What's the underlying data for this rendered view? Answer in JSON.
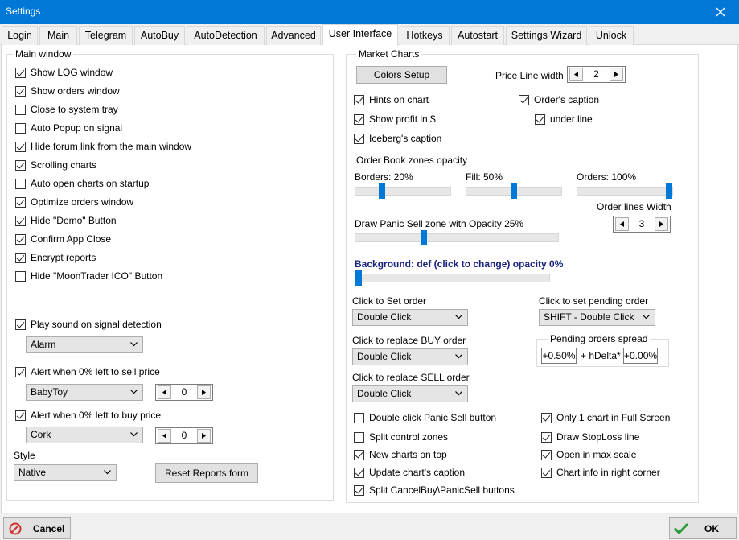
{
  "window": {
    "title": "Settings"
  },
  "tabs": [
    "Login",
    "Main",
    "Telegram",
    "AutoBuy",
    "AutoDetection",
    "Advanced",
    "User Interface",
    "Hotkeys",
    "Autostart",
    "Settings Wizard",
    "Unlock"
  ],
  "main_window": {
    "title": "Main window",
    "checks": [
      {
        "label": "Show LOG window",
        "checked": true
      },
      {
        "label": "Show orders window",
        "checked": true
      },
      {
        "label": "Close to system tray",
        "checked": false
      },
      {
        "label": "Auto Popup on signal",
        "checked": false
      },
      {
        "label": "Hide forum link from the main window",
        "checked": true
      },
      {
        "label": "Scrolling charts",
        "checked": true
      },
      {
        "label": "Auto open charts on startup",
        "checked": false
      },
      {
        "label": "Optimize orders window",
        "checked": true
      },
      {
        "label": "Hide \"Demo\" Button",
        "checked": true
      },
      {
        "label": "Confirm App Close",
        "checked": true
      },
      {
        "label": "Encrypt reports",
        "checked": true
      },
      {
        "label": "Hide \"MoonTrader ICO\" Button",
        "checked": false
      }
    ],
    "play_sound": {
      "label": "Play sound on signal detection",
      "checked": true,
      "value": "Alarm"
    },
    "alert_sell": {
      "label": "Alert when 0% left to sell price",
      "checked": true,
      "value": "BabyToy",
      "spin": "0"
    },
    "alert_buy": {
      "label": "Alert when 0% left to buy price",
      "checked": true,
      "value": "Cork",
      "spin": "0"
    },
    "style": {
      "label": "Style",
      "value": "Native"
    },
    "reset_button": "Reset Reports form"
  },
  "market_charts": {
    "title": "Market Charts",
    "colors_button": "Colors Setup",
    "price_line": {
      "label": "Price Line width",
      "value": "2"
    },
    "hints": {
      "label": "Hints on chart",
      "checked": true
    },
    "profit": {
      "label": "Show profit in $",
      "checked": true
    },
    "iceberg": {
      "label": "Iceberg's caption",
      "checked": true
    },
    "order_caption": {
      "label": "Order's caption",
      "checked": true
    },
    "under_line": {
      "label": "under line",
      "checked": true
    },
    "order_book_title": "Order Book zones opacity",
    "borders": {
      "label": "Borders: 20%",
      "value": 20
    },
    "fill": {
      "label": "Fill: 50%",
      "value": 50
    },
    "orders": {
      "label": "Orders: 100%",
      "value": 100
    },
    "order_lines": {
      "label": "Order lines Width",
      "value": "3"
    },
    "panic": {
      "label": "Draw Panic Sell zone with Opacity 25%",
      "value": 25
    },
    "background": {
      "label": "Background: def (click to change) opacity 0%",
      "value": 0,
      "color": "#1a237e"
    },
    "click_set": {
      "label": "Click to Set order",
      "value": "Double Click"
    },
    "click_buy": {
      "label": "Click to replace BUY order",
      "value": "Double Click"
    },
    "click_sell": {
      "label": "Click to replace SELL order",
      "value": "Double Click"
    },
    "click_pending": {
      "label": "Click to set pending order",
      "value": "SHIFT - Double Click"
    },
    "pending_spread": {
      "title": "Pending orders spread",
      "left": "+0.50%",
      "mid": "+ hDelta*",
      "right": "+0.00%"
    },
    "bottom_checks_left": [
      {
        "label": "Double click Panic Sell button",
        "checked": false
      },
      {
        "label": "Split control zones",
        "checked": false
      },
      {
        "label": "New charts on top",
        "checked": true
      },
      {
        "label": "Update chart's caption",
        "checked": true
      },
      {
        "label": "Split CancelBuy\\PanicSell buttons",
        "checked": true
      }
    ],
    "bottom_checks_right": [
      {
        "label": "Only 1 chart in Full Screen",
        "checked": true
      },
      {
        "label": "Draw StopLoss line",
        "checked": true
      },
      {
        "label": "Open in max scale",
        "checked": true
      },
      {
        "label": "Chart info in right corner",
        "checked": true
      }
    ]
  },
  "footer": {
    "cancel": "Cancel",
    "ok": "OK"
  },
  "colors": {
    "accent": "#0078d7",
    "link": "#1a237e"
  }
}
